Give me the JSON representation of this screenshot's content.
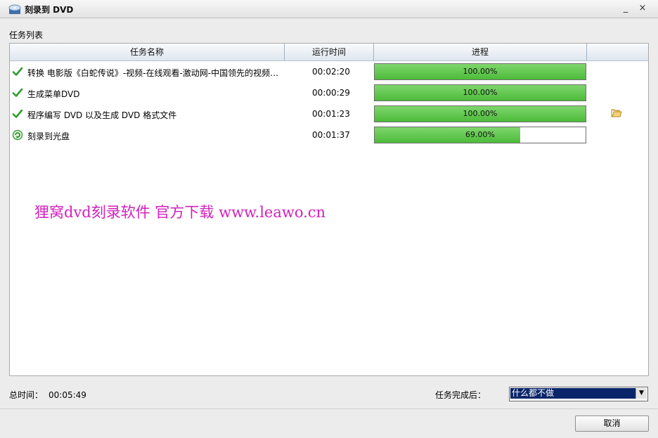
{
  "window": {
    "title": "刻录到 DVD",
    "minimize_glyph": "_",
    "close_glyph": "×"
  },
  "section_label": "任务列表",
  "table": {
    "columns": [
      "任务名称",
      "运行时间",
      "进程",
      ""
    ],
    "rows": [
      {
        "status_icon": "check-icon",
        "name": "转换 电影版《白蛇传说》-视频-在线观看-激动网-中国领先的视频…",
        "time": "00:02:20",
        "progress_label": "100.00%",
        "progress": 1.0,
        "has_folder": false
      },
      {
        "status_icon": "check-icon",
        "name": "生成菜单DVD",
        "time": "00:00:29",
        "progress_label": "100.00%",
        "progress": 1.0,
        "has_folder": false
      },
      {
        "status_icon": "check-icon",
        "name": "程序编写 DVD 以及生成 DVD 格式文件",
        "time": "00:01:23",
        "progress_label": "100.00%",
        "progress": 1.0,
        "has_folder": true
      },
      {
        "status_icon": "in-progress-icon",
        "name": "刻录到光盘",
        "time": "00:01:37",
        "progress_label": "69.00%",
        "progress": 0.69,
        "has_folder": false
      }
    ]
  },
  "watermark": "狸窝dvd刻录软件 官方下载 www.leawo.cn",
  "footer": {
    "total_time_label": "总时间：",
    "total_time_value": "00:05:49",
    "after_complete_label": "任务完成后：",
    "after_complete_value": "什么都不做",
    "cancel_label": "取消"
  },
  "colors": {
    "progress_fill": "#4dbb3a",
    "watermark": "#d21fbd",
    "select_highlight": "#0a246a"
  }
}
